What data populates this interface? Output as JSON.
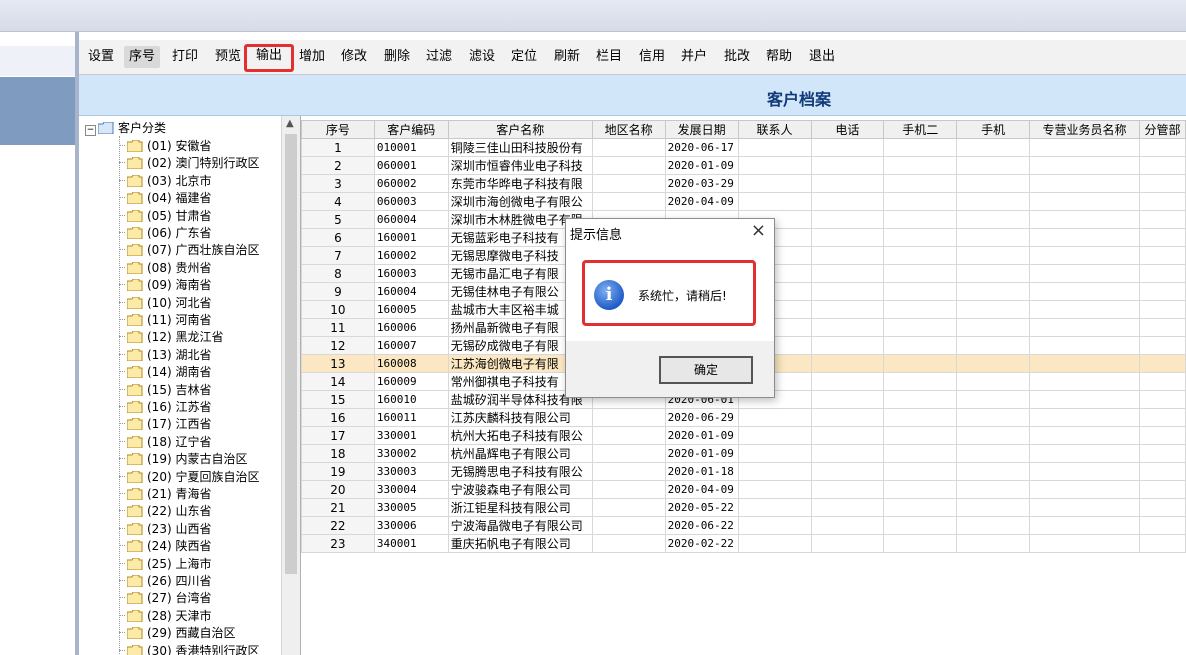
{
  "toolbar": {
    "buttons": [
      "设置",
      "序号",
      "打印",
      "预览",
      "输出",
      "增加",
      "修改",
      "删除",
      "过滤",
      "滤设",
      "定位",
      "刷新",
      "栏目",
      "信用",
      "并户",
      "批改",
      "帮助",
      "退出"
    ]
  },
  "banner": {
    "title": "客户档案"
  },
  "tree": {
    "root": "客户分类",
    "items": [
      "(01) 安徽省",
      "(02) 澳门特别行政区",
      "(03) 北京市",
      "(04) 福建省",
      "(05) 甘肃省",
      "(06) 广东省",
      "(07) 广西壮族自治区",
      "(08) 贵州省",
      "(09) 海南省",
      "(10) 河北省",
      "(11) 河南省",
      "(12) 黑龙江省",
      "(13) 湖北省",
      "(14) 湖南省",
      "(15) 吉林省",
      "(16) 江苏省",
      "(17) 江西省",
      "(18) 辽宁省",
      "(19) 内蒙古自治区",
      "(20) 宁夏回族自治区",
      "(21) 青海省",
      "(22) 山东省",
      "(23) 山西省",
      "(24) 陕西省",
      "(25) 上海市",
      "(26) 四川省",
      "(27) 台湾省",
      "(28) 天津市",
      "(29) 西藏自治区",
      "(30) 香港特别行政区"
    ]
  },
  "grid": {
    "columns": [
      "序号",
      "客户编码",
      "客户名称",
      "地区名称",
      "发展日期",
      "联系人",
      "电话",
      "手机二",
      "手机",
      "专营业务员名称",
      "分管部"
    ],
    "rows": [
      [
        "1",
        "010001",
        "铜陵三佳山田科技股份有",
        "",
        "2020-06-17"
      ],
      [
        "2",
        "060001",
        "深圳市恒睿伟业电子科技",
        "",
        "2020-01-09"
      ],
      [
        "3",
        "060002",
        "东莞市华晔电子科技有限",
        "",
        "2020-03-29"
      ],
      [
        "4",
        "060003",
        "深圳市海创微电子有限公",
        "",
        "2020-04-09"
      ],
      [
        "5",
        "060004",
        "深圳市木林胜微电子有限",
        "",
        ""
      ],
      [
        "6",
        "160001",
        "无锡蓝彩电子科技有",
        "",
        ""
      ],
      [
        "7",
        "160002",
        "无锡思摩微电子科技",
        "",
        ""
      ],
      [
        "8",
        "160003",
        "无锡市晶汇电子有限",
        "",
        ""
      ],
      [
        "9",
        "160004",
        "无锡佳林电子有限公",
        "",
        ""
      ],
      [
        "10",
        "160005",
        "盐城市大丰区裕丰城",
        "",
        ""
      ],
      [
        "11",
        "160006",
        "扬州晶新微电子有限",
        "",
        ""
      ],
      [
        "12",
        "160007",
        "无锡矽成微电子有限",
        "",
        ""
      ],
      [
        "13",
        "160008",
        "江苏海创微电子有限",
        "",
        ""
      ],
      [
        "14",
        "160009",
        "常州御祺电子科技有",
        "",
        ""
      ],
      [
        "15",
        "160010",
        "盐城矽润半导体科技有限",
        "",
        "2020-06-01"
      ],
      [
        "16",
        "160011",
        "江苏庆麟科技有限公司",
        "",
        "2020-06-29"
      ],
      [
        "17",
        "330001",
        "杭州大拓电子科技有限公",
        "",
        "2020-01-09"
      ],
      [
        "18",
        "330002",
        "杭州晶辉电子有限公司",
        "",
        "2020-01-09"
      ],
      [
        "19",
        "330003",
        "无锡腾思电子科技有限公",
        "",
        "2020-01-18"
      ],
      [
        "20",
        "330004",
        "宁波骏森电子有限公司",
        "",
        "2020-04-09"
      ],
      [
        "21",
        "330005",
        "浙江钜星科技有限公司",
        "",
        "2020-05-22"
      ],
      [
        "22",
        "330006",
        "宁波海晶微电子有限公司",
        "",
        "2020-06-22"
      ],
      [
        "23",
        "340001",
        "重庆拓帆电子有限公司",
        "",
        "2020-02-22"
      ]
    ],
    "highlighted_row": 13
  },
  "dialog": {
    "title": "提示信息",
    "close": "×",
    "icon": "info-icon",
    "message": "系统忙，请稍后!",
    "ok_label": "确定"
  },
  "colors": {
    "banner_bg": "#d1e6f8",
    "highlight_box": "#e23030",
    "highlight_row": "#fbe8c2"
  }
}
